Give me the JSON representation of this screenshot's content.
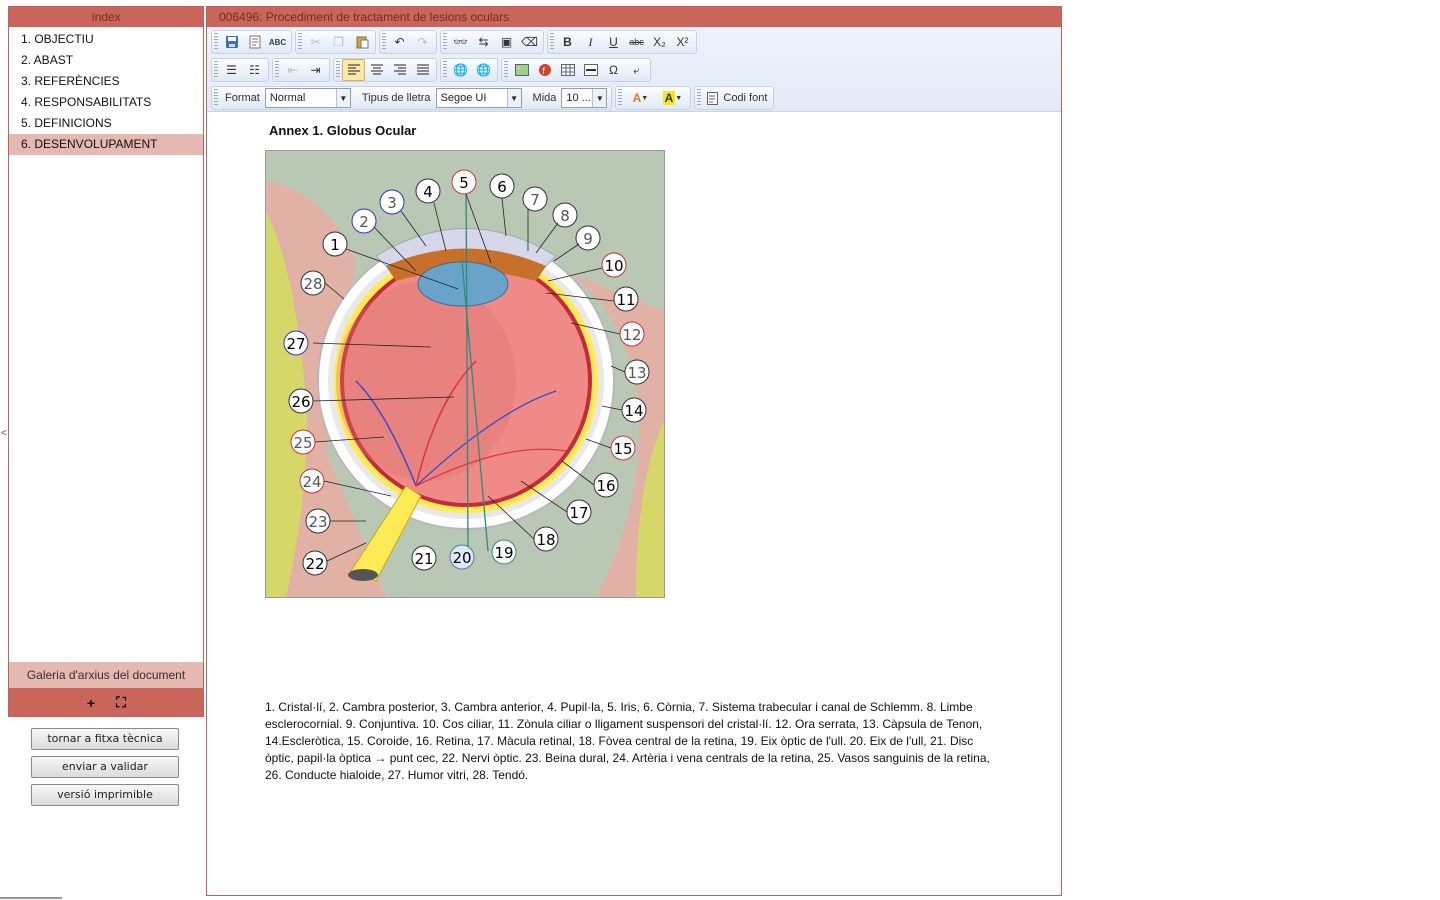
{
  "left": {
    "title": "índex",
    "items": [
      {
        "label": "1. OBJECTIU"
      },
      {
        "label": "2. ABAST"
      },
      {
        "label": "3. REFERÈNCIES"
      },
      {
        "label": "4. RESPONSABILITATS"
      },
      {
        "label": "5. DEFINICIONS"
      },
      {
        "label": "6. DESENVOLUPAMENT",
        "active": true
      }
    ],
    "gallery": "Galeria d'arxius del document",
    "gallery_add": "+",
    "gallery_expand": "⛶",
    "buttons": {
      "back": "tornar a fitxa tècnica",
      "validate": "enviar a validar",
      "print": "versió imprimible"
    },
    "collapse": "<"
  },
  "main": {
    "title": "006496: Procediment de tractament de lesions oculars",
    "toolbar": {
      "format_label": "Format",
      "format_value": "Normal",
      "font_label": "Tipus de lletra",
      "font_value": "Segoe UI",
      "size_label": "Mida",
      "size_value": "10 ...",
      "source_label": "Codi font",
      "icons": {
        "bold": "B",
        "italic": "I",
        "underline": "U",
        "strike": "abc",
        "sub": "X₂",
        "sup": "X²",
        "omega": "Ω"
      }
    },
    "annex_title": "Annex 1. Globus Ocular",
    "figure_numbers": [
      "1",
      "2",
      "3",
      "4",
      "5",
      "6",
      "7",
      "8",
      "9",
      "10",
      "11",
      "12",
      "13",
      "14",
      "15",
      "16",
      "17",
      "18",
      "19",
      "20",
      "21",
      "22",
      "23",
      "24",
      "25",
      "26",
      "27",
      "28"
    ],
    "legend": "1. Cristal·lí, 2. Cambra posterior, 3. Cambra anterior, 4. Pupil·la, 5. Iris, 6. Còrnia, 7. Sistema trabecular i canal de Schlemm. 8. Limbe esclerocornial. 9. Conjuntiva. 10. Cos ciliar, 11. Zònula ciliar o lligament suspensori del cristal·lí. 12. Ora serrata, 13. Càpsula de Tenon, 14.Escleròtica, 15. Coroide, 16. Retina, 17. Màcula retinal, 18. Fòvea central de la retina, 19. Eix òptic de l'ull. 20. Eix de l'ull, 21. Disc òptic, papil·la òptica → punt cec, 22. Nervi òptic. 23. Beina dural, 24. Artèria i vena centrals de la retina, 25. Vasos sanguinis de la retina, 26. Conducte hialoide, 27. Humor vitri, 28. Tendó."
  },
  "colors": {
    "header": "#c9655b",
    "active": "#e5b8b2",
    "background_fig": "#b9c8b5",
    "tissue": "#e2b1a5",
    "fat": "#d6d769",
    "vitreous": "#f08a87"
  }
}
